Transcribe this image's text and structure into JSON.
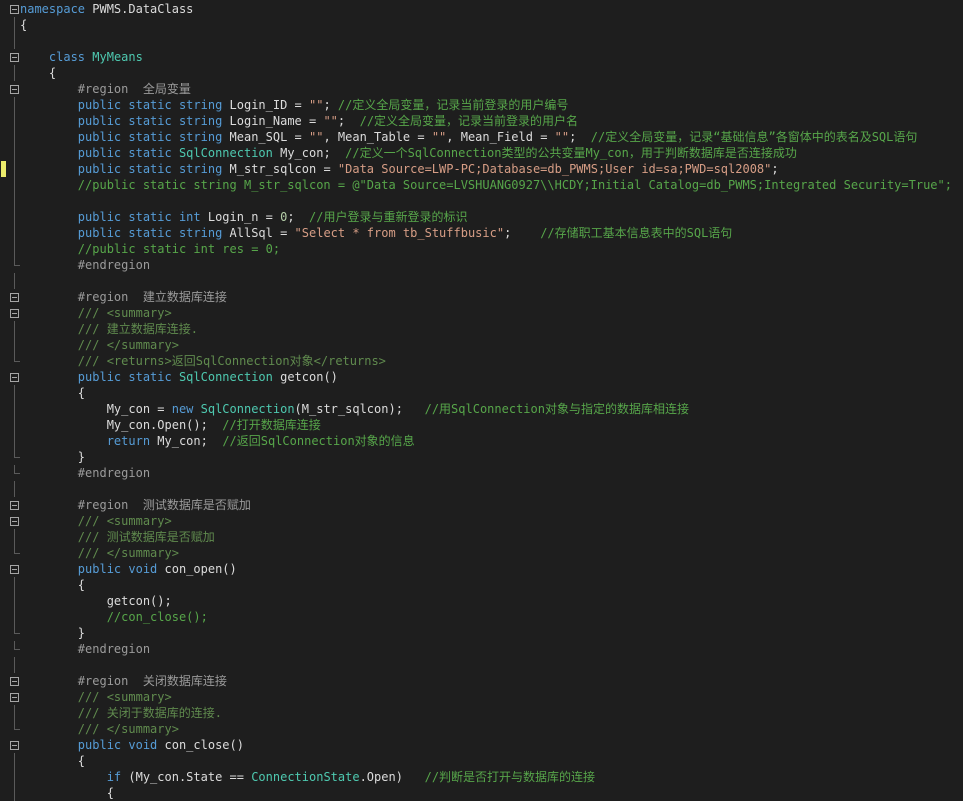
{
  "editor": {
    "language": "C#",
    "lines": [
      {
        "fold": "open",
        "tokens": [
          [
            "kw",
            "namespace"
          ],
          [
            "id",
            " PWMS.DataClass"
          ]
        ]
      },
      {
        "fold": "bar",
        "tokens": [
          [
            "id",
            "{"
          ]
        ]
      },
      {
        "fold": "bar",
        "tokens": []
      },
      {
        "fold": "open",
        "tokens": [
          [
            "id",
            "    "
          ],
          [
            "kw",
            "class"
          ],
          [
            "id",
            " "
          ],
          [
            "type",
            "MyMeans"
          ]
        ]
      },
      {
        "fold": "bar",
        "tokens": [
          [
            "id",
            "    {"
          ]
        ]
      },
      {
        "fold": "open",
        "tokens": [
          [
            "id",
            "        "
          ],
          [
            "pre",
            "#region  全局变量"
          ]
        ]
      },
      {
        "fold": "bar",
        "tokens": [
          [
            "id",
            "        "
          ],
          [
            "kw",
            "public static string"
          ],
          [
            "id",
            " Login_ID = "
          ],
          [
            "str",
            "\"\""
          ],
          [
            "id",
            "; "
          ],
          [
            "cm",
            "//定义全局变量，记录当前登录的用户编号"
          ]
        ]
      },
      {
        "fold": "bar",
        "tokens": [
          [
            "id",
            "        "
          ],
          [
            "kw",
            "public static string"
          ],
          [
            "id",
            " Login_Name = "
          ],
          [
            "str",
            "\"\""
          ],
          [
            "id",
            ";  "
          ],
          [
            "cm",
            "//定义全局变量，记录当前登录的用户名"
          ]
        ]
      },
      {
        "fold": "bar",
        "tokens": [
          [
            "id",
            "        "
          ],
          [
            "kw",
            "public static string"
          ],
          [
            "id",
            " Mean_SQL = "
          ],
          [
            "str",
            "\"\""
          ],
          [
            "id",
            ", Mean_Table = "
          ],
          [
            "str",
            "\"\""
          ],
          [
            "id",
            ", Mean_Field = "
          ],
          [
            "str",
            "\"\""
          ],
          [
            "id",
            ";  "
          ],
          [
            "cm",
            "//定义全局变量，记录“基础信息”各窗体中的表名及SQL语句"
          ]
        ]
      },
      {
        "fold": "bar",
        "tokens": [
          [
            "id",
            "        "
          ],
          [
            "kw",
            "public static "
          ],
          [
            "type",
            "SqlConnection"
          ],
          [
            "id",
            " My_con;  "
          ],
          [
            "cm",
            "//定义一个SqlConnection类型的公共变量My_con，用于判断数据库是否连接成功"
          ]
        ]
      },
      {
        "fold": "bar",
        "change": true,
        "tokens": [
          [
            "id",
            "        "
          ],
          [
            "kw",
            "public static string"
          ],
          [
            "id",
            " M_str_sqlcon = "
          ],
          [
            "str",
            "\"Data Source=LWP-PC;Database=db_PWMS;User id=sa;PWD=sql2008\""
          ],
          [
            "id",
            ";"
          ]
        ]
      },
      {
        "fold": "bar",
        "tokens": [
          [
            "id",
            "        "
          ],
          [
            "cm",
            "//public static string M_str_sqlcon = @\"Data Source=LVSHUANG0927\\\\HCDY;Initial Catalog=db_PWMS;Integrated Security=True\";"
          ]
        ]
      },
      {
        "fold": "bar",
        "tokens": []
      },
      {
        "fold": "bar",
        "tokens": [
          [
            "id",
            "        "
          ],
          [
            "kw",
            "public static int"
          ],
          [
            "id",
            " Login_n = "
          ],
          [
            "num",
            "0"
          ],
          [
            "id",
            ";  "
          ],
          [
            "cm",
            "//用户登录与重新登录的标识"
          ]
        ]
      },
      {
        "fold": "bar",
        "tokens": [
          [
            "id",
            "        "
          ],
          [
            "kw",
            "public static string"
          ],
          [
            "id",
            " AllSql = "
          ],
          [
            "str",
            "\"Select * from tb_Stuffbusic\""
          ],
          [
            "id",
            ";    "
          ],
          [
            "cm",
            "//存储职工基本信息表中的SQL语句"
          ]
        ]
      },
      {
        "fold": "bar",
        "tokens": [
          [
            "id",
            "        "
          ],
          [
            "cm",
            "//public static int res = 0;"
          ]
        ]
      },
      {
        "fold": "end",
        "tokens": [
          [
            "id",
            "        "
          ],
          [
            "pre",
            "#endregion"
          ]
        ]
      },
      {
        "fold": "bar",
        "tokens": []
      },
      {
        "fold": "open",
        "tokens": [
          [
            "id",
            "        "
          ],
          [
            "pre",
            "#region  建立数据库连接"
          ]
        ]
      },
      {
        "fold": "open",
        "tokens": [
          [
            "id",
            "        "
          ],
          [
            "doc",
            "/// "
          ],
          [
            "doctag",
            "<summary>"
          ]
        ]
      },
      {
        "fold": "bar",
        "tokens": [
          [
            "id",
            "        "
          ],
          [
            "doc",
            "/// 建立数据库连接."
          ]
        ]
      },
      {
        "fold": "bar",
        "tokens": [
          [
            "id",
            "        "
          ],
          [
            "doc",
            "/// "
          ],
          [
            "doctag",
            "</summary>"
          ]
        ]
      },
      {
        "fold": "end",
        "tokens": [
          [
            "id",
            "        "
          ],
          [
            "doc",
            "/// "
          ],
          [
            "doctag",
            "<returns>"
          ],
          [
            "doc",
            "返回SqlConnection对象"
          ],
          [
            "doctag",
            "</returns>"
          ]
        ]
      },
      {
        "fold": "open",
        "tokens": [
          [
            "id",
            "        "
          ],
          [
            "kw",
            "public static "
          ],
          [
            "type",
            "SqlConnection"
          ],
          [
            "id",
            " getcon()"
          ]
        ]
      },
      {
        "fold": "bar",
        "tokens": [
          [
            "id",
            "        {"
          ]
        ]
      },
      {
        "fold": "bar",
        "tokens": [
          [
            "id",
            "            My_con = "
          ],
          [
            "kw",
            "new "
          ],
          [
            "type",
            "SqlConnection"
          ],
          [
            "id",
            "(M_str_sqlcon);   "
          ],
          [
            "cm",
            "//用SqlConnection对象与指定的数据库相连接"
          ]
        ]
      },
      {
        "fold": "bar",
        "tokens": [
          [
            "id",
            "            My_con.Open();  "
          ],
          [
            "cm",
            "//打开数据库连接"
          ]
        ]
      },
      {
        "fold": "bar",
        "tokens": [
          [
            "id",
            "            "
          ],
          [
            "kw",
            "return"
          ],
          [
            "id",
            " My_con;  "
          ],
          [
            "cm",
            "//返回SqlConnection对象的信息"
          ]
        ]
      },
      {
        "fold": "end",
        "tokens": [
          [
            "id",
            "        }"
          ]
        ]
      },
      {
        "fold": "end",
        "tokens": [
          [
            "id",
            "        "
          ],
          [
            "pre",
            "#endregion"
          ]
        ]
      },
      {
        "fold": "bar",
        "tokens": []
      },
      {
        "fold": "open",
        "tokens": [
          [
            "id",
            "        "
          ],
          [
            "pre",
            "#region  测试数据库是否赋加"
          ]
        ]
      },
      {
        "fold": "open",
        "tokens": [
          [
            "id",
            "        "
          ],
          [
            "doc",
            "/// "
          ],
          [
            "doctag",
            "<summary>"
          ]
        ]
      },
      {
        "fold": "bar",
        "tokens": [
          [
            "id",
            "        "
          ],
          [
            "doc",
            "/// 测试数据库是否赋加"
          ]
        ]
      },
      {
        "fold": "end",
        "tokens": [
          [
            "id",
            "        "
          ],
          [
            "doc",
            "/// "
          ],
          [
            "doctag",
            "</summary>"
          ]
        ]
      },
      {
        "fold": "open",
        "tokens": [
          [
            "id",
            "        "
          ],
          [
            "kw",
            "public void"
          ],
          [
            "id",
            " con_open()"
          ]
        ]
      },
      {
        "fold": "bar",
        "tokens": [
          [
            "id",
            "        {"
          ]
        ]
      },
      {
        "fold": "bar",
        "tokens": [
          [
            "id",
            "            getcon();"
          ]
        ]
      },
      {
        "fold": "bar",
        "tokens": [
          [
            "id",
            "            "
          ],
          [
            "cm",
            "//con_close();"
          ]
        ]
      },
      {
        "fold": "end",
        "tokens": [
          [
            "id",
            "        }"
          ]
        ]
      },
      {
        "fold": "end",
        "tokens": [
          [
            "id",
            "        "
          ],
          [
            "pre",
            "#endregion"
          ]
        ]
      },
      {
        "fold": "bar",
        "tokens": []
      },
      {
        "fold": "open",
        "tokens": [
          [
            "id",
            "        "
          ],
          [
            "pre",
            "#region  关闭数据库连接"
          ]
        ]
      },
      {
        "fold": "open",
        "tokens": [
          [
            "id",
            "        "
          ],
          [
            "doc",
            "/// "
          ],
          [
            "doctag",
            "<summary>"
          ]
        ]
      },
      {
        "fold": "bar",
        "tokens": [
          [
            "id",
            "        "
          ],
          [
            "doc",
            "/// 关闭于数据库的连接."
          ]
        ]
      },
      {
        "fold": "end",
        "tokens": [
          [
            "id",
            "        "
          ],
          [
            "doc",
            "/// "
          ],
          [
            "doctag",
            "</summary>"
          ]
        ]
      },
      {
        "fold": "open",
        "tokens": [
          [
            "id",
            "        "
          ],
          [
            "kw",
            "public void"
          ],
          [
            "id",
            " con_close()"
          ]
        ]
      },
      {
        "fold": "bar",
        "tokens": [
          [
            "id",
            "        {"
          ]
        ]
      },
      {
        "fold": "bar",
        "tokens": [
          [
            "id",
            "            "
          ],
          [
            "kw",
            "if"
          ],
          [
            "id",
            " (My_con.State == "
          ],
          [
            "type",
            "ConnectionState"
          ],
          [
            "id",
            ".Open)   "
          ],
          [
            "cm",
            "//判断是否打开与数据库的连接"
          ]
        ]
      },
      {
        "fold": "bar",
        "tokens": [
          [
            "id",
            "            {"
          ]
        ]
      }
    ]
  },
  "colors": {
    "background": "#1e1e1e",
    "keyword": "#569cd6",
    "type": "#4ec9b0",
    "string": "#d69d85",
    "comment": "#57a64a",
    "preprocessor": "#9b9b9b",
    "text": "#dcdcdc"
  }
}
